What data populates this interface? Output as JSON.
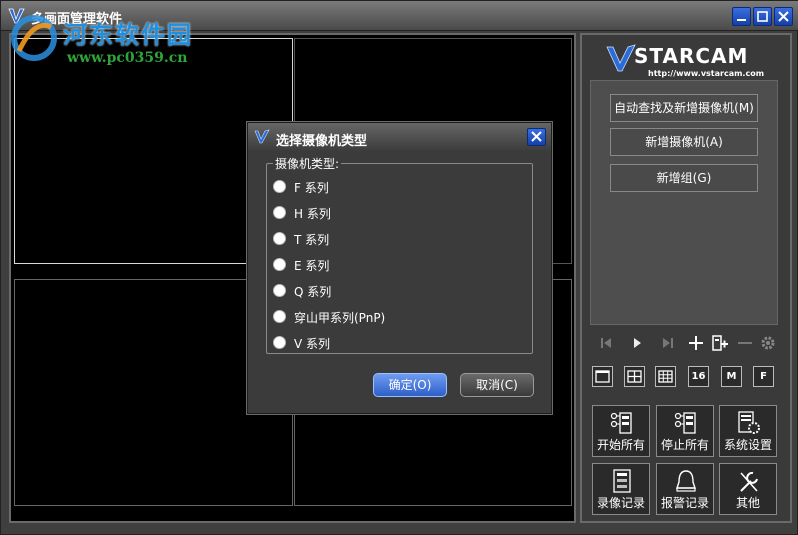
{
  "window": {
    "title": "多画面管理软件",
    "controls": {
      "minimize_icon": "minimize-icon",
      "maximize_icon": "maximize-icon",
      "close_icon": "close-icon"
    }
  },
  "watermark": {
    "name": "河东软件园",
    "url": "www.pc0359.cn"
  },
  "brand": {
    "logo_text": "STARCAM",
    "url": "http://www.vstarcam.com"
  },
  "actions": {
    "auto_search_add": "自动查找及新增摄像机(M)",
    "add_camera": "新增摄像机(A)",
    "add_group": "新增组(G)"
  },
  "ptz_icons": [
    "skip-previous-icon",
    "play-icon",
    "skip-next-icon",
    "plus-icon",
    "add-camera-icon",
    "minus-icon",
    "gear-icon"
  ],
  "layout_buttons": [
    {
      "icon": "layout-1-icon",
      "label": ""
    },
    {
      "icon": "layout-4-icon",
      "label": ""
    },
    {
      "icon": "layout-9-icon",
      "label": ""
    },
    {
      "icon": "layout-16-icon",
      "label": "16"
    },
    {
      "icon": "layout-m-icon",
      "label": "M"
    },
    {
      "icon": "fullscreen-icon",
      "label": "F"
    }
  ],
  "tiles": {
    "start_all": "开始所有",
    "stop_all": "停止所有",
    "system_settings": "系统设置",
    "recordings": "录像记录",
    "alarm_log": "报警记录",
    "other": "其他"
  },
  "dialog": {
    "title": "选择摄像机类型",
    "group_label": "摄像机类型:",
    "options": [
      "F 系列",
      "H 系列",
      "T 系列",
      "E 系列",
      "Q 系列",
      "穿山甲系列(PnP)",
      "V 系列"
    ],
    "ok": "确定(O)",
    "cancel": "取消(C)"
  },
  "colors": {
    "accent_blue": "#2e5fc8",
    "watermark_blue": "#1f8fe0",
    "watermark_green": "#2ea43a",
    "background": "#3f3f3f"
  }
}
